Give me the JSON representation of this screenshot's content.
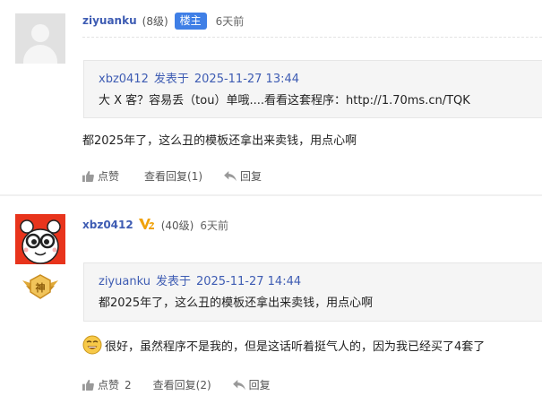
{
  "post1": {
    "username": "ziyuanku",
    "level": "(8级)",
    "op_badge": "楼主",
    "time": "6天前",
    "quote": {
      "author": "xbz0412",
      "posted_label": "发表于",
      "datetime": "2025-11-27 13:44",
      "text": "大 X 客？容易丢（tou）单哦....看看这套程序：http://1.70ms.cn/TQK"
    },
    "content": "都2025年了，这么丑的模板还拿出来卖钱，用点心啊",
    "actions": {
      "like": "点赞",
      "view_replies": "查看回复(1)",
      "reply": "回复"
    }
  },
  "post2": {
    "username": "xbz0412",
    "vip": "V2",
    "level": "(40级)",
    "time": "6天前",
    "medal_text": "神",
    "quote": {
      "author": "ziyuanku",
      "posted_label": "发表于",
      "datetime": "2025-11-27 14:44",
      "text": "都2025年了，这么丑的模板还拿出来卖钱，用点心啊"
    },
    "content": "很好，虽然程序不是我的，但是这话听着挺气人的，因为我已经买了4套了",
    "actions": {
      "like": "点赞",
      "like_count": "2",
      "view_replies": "查看回复(2)",
      "reply": "回复"
    }
  },
  "colors": {
    "link_blue": "#3e5cb3",
    "badge_blue": "#3f7fe6",
    "avatar_red": "#e8341c",
    "vip_gold": "#f0a20a"
  },
  "icons": [
    "thumbs-up-icon",
    "reply-arrow-icon",
    "smiley-emoji-icon",
    "medal-icon",
    "vip-icon",
    "default-avatar-icon"
  ]
}
